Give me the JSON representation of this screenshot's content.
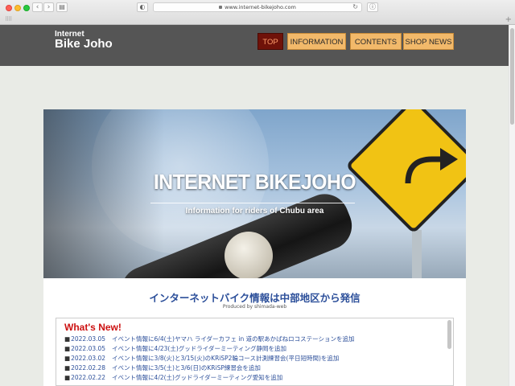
{
  "browser": {
    "url": "www.internet-bikejoho.com"
  },
  "site": {
    "logo_small": "Internet",
    "logo_main": "Bike Joho"
  },
  "nav": {
    "items": [
      {
        "label": "TOP",
        "active": true
      },
      {
        "label": "INFORMATION",
        "active": false
      },
      {
        "label": "CONTENTS",
        "active": false
      },
      {
        "label": "SHOP NEWS",
        "active": false
      }
    ]
  },
  "hero": {
    "title": "INTERNET BIKEJOHO",
    "subtitle": "Information for riders of Chubu area"
  },
  "main": {
    "heading": "インターネットバイク情報は中部地区から発信",
    "produced_by": "Produced by shimada-web"
  },
  "news": {
    "title": "What's New!",
    "bullet": "■",
    "items": [
      {
        "date": "2022.03.05",
        "text": "イベント情報に6/4(土)ヤマハ ライダーカフェ in 道の駅あかばねロコステーションを追加"
      },
      {
        "date": "2022.03.05",
        "text": "イベント情報に4/23(土)グッドライダーミーティング静岡を追加"
      },
      {
        "date": "2022.03.02",
        "text": "イベント情報に3/8(火)と3/15(火)のKRiSP2輪コース計測練習会(平日短時間)を追加"
      },
      {
        "date": "2022.02.28",
        "text": "イベント情報に3/5(土)と3/6(日)のKRiSP練習会を追加"
      },
      {
        "date": "2022.02.22",
        "text": "イベント情報に4/2(土)グッドライダーミーティング愛知を追加"
      }
    ]
  },
  "colors": {
    "header_bg": "#555555",
    "nav_active_bg": "#6f1209",
    "nav_bg": "#f2b96a",
    "heading_blue": "#2c4f9a",
    "news_title_red": "#cc1111"
  }
}
